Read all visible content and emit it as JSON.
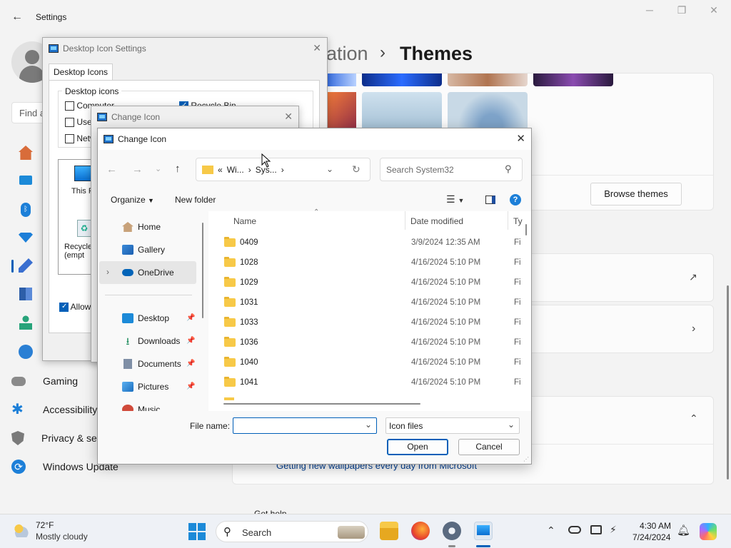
{
  "settings": {
    "title": "Settings",
    "breadcrumb_prefix": "ation",
    "breadcrumb_sep": "›",
    "page_title": "Themes",
    "search_placeholder": "Find a",
    "browse_themes": "Browse themes",
    "nav_items": [
      "Gaming",
      "Accessibility",
      "Privacy & se",
      "Windows Update"
    ],
    "footer_link": "Getting new wallpapers every day from Microsoft",
    "get_help": "Get help"
  },
  "desktop_icon_settings": {
    "title": "Desktop Icon Settings",
    "tab": "Desktop Icons",
    "group_label": "Desktop icons",
    "checkboxes": [
      "Computer",
      "User",
      "Netw",
      "Recycle Bin"
    ],
    "icons": [
      "This P",
      "Recycle (empt"
    ],
    "allow_themes": "Allow t"
  },
  "change_icon_back": {
    "title": "Change Icon"
  },
  "file_dialog": {
    "title": "Change Icon",
    "address": [
      "Wi...",
      "Sys..."
    ],
    "address_prefix": "«",
    "search_placeholder": "Search System32",
    "organize": "Organize",
    "new_folder": "New folder",
    "sidebar": [
      {
        "label": "Home"
      },
      {
        "label": "Gallery"
      },
      {
        "label": "OneDrive"
      },
      {
        "label": "Desktop"
      },
      {
        "label": "Downloads"
      },
      {
        "label": "Documents"
      },
      {
        "label": "Pictures"
      },
      {
        "label": "Music"
      }
    ],
    "columns": {
      "name": "Name",
      "date": "Date modified",
      "type": "Ty"
    },
    "files": [
      {
        "name": "0409",
        "date": "3/9/2024 12:35 AM",
        "type": "Fi"
      },
      {
        "name": "1028",
        "date": "4/16/2024 5:10 PM",
        "type": "Fi"
      },
      {
        "name": "1029",
        "date": "4/16/2024 5:10 PM",
        "type": "Fi"
      },
      {
        "name": "1031",
        "date": "4/16/2024 5:10 PM",
        "type": "Fi"
      },
      {
        "name": "1033",
        "date": "4/16/2024 5:10 PM",
        "type": "Fi"
      },
      {
        "name": "1036",
        "date": "4/16/2024 5:10 PM",
        "type": "Fi"
      },
      {
        "name": "1040",
        "date": "4/16/2024 5:10 PM",
        "type": "Fi"
      },
      {
        "name": "1041",
        "date": "4/16/2024 5:10 PM",
        "type": "Fi"
      }
    ],
    "file_name_label": "File name:",
    "file_name_value": "",
    "file_type": "Icon files",
    "open": "Open",
    "cancel": "Cancel"
  },
  "taskbar": {
    "weather_temp": "72°F",
    "weather_desc": "Mostly cloudy",
    "search": "Search",
    "time": "4:30 AM",
    "date": "7/24/2024"
  },
  "colors": {
    "accent": "#005fb8",
    "folder": "#f7c948",
    "onedrive": "#0364b8"
  }
}
